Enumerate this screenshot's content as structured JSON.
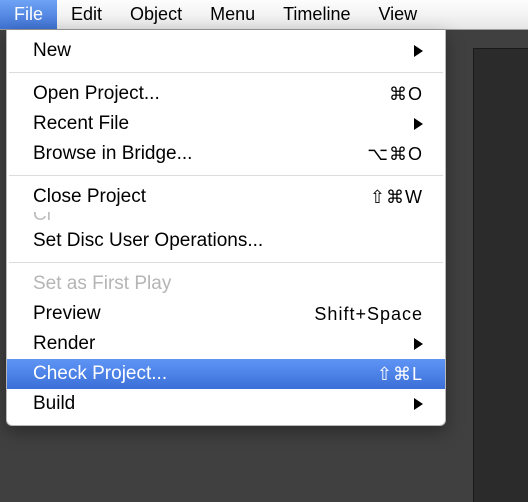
{
  "menubar": {
    "items": [
      {
        "label": "File",
        "active": true
      },
      {
        "label": "Edit",
        "active": false
      },
      {
        "label": "Object",
        "active": false
      },
      {
        "label": "Menu",
        "active": false
      },
      {
        "label": "Timeline",
        "active": false
      },
      {
        "label": "View",
        "active": false
      }
    ]
  },
  "file_menu": {
    "groups": [
      [
        {
          "label": "New",
          "submenu": true
        }
      ],
      [
        {
          "label": "Open Project...",
          "shortcut": "⌘O"
        },
        {
          "label": "Recent File",
          "submenu": true
        },
        {
          "label": "Browse in Bridge...",
          "shortcut": "⌥⌘O"
        }
      ],
      [
        {
          "label": "Close Project",
          "shortcut": "⇧⌘W"
        },
        {
          "label_truncated": "Cl"
        },
        {
          "label": "Set Disc User Operations..."
        }
      ],
      [
        {
          "label": "Set as First Play",
          "disabled": true
        },
        {
          "label": "Preview",
          "shortcut": "Shift+Space"
        },
        {
          "label": "Render",
          "submenu": true
        },
        {
          "label": "Check Project...",
          "shortcut": "⇧⌘L",
          "highlight": true
        },
        {
          "label": "Build",
          "submenu": true
        }
      ]
    ]
  }
}
